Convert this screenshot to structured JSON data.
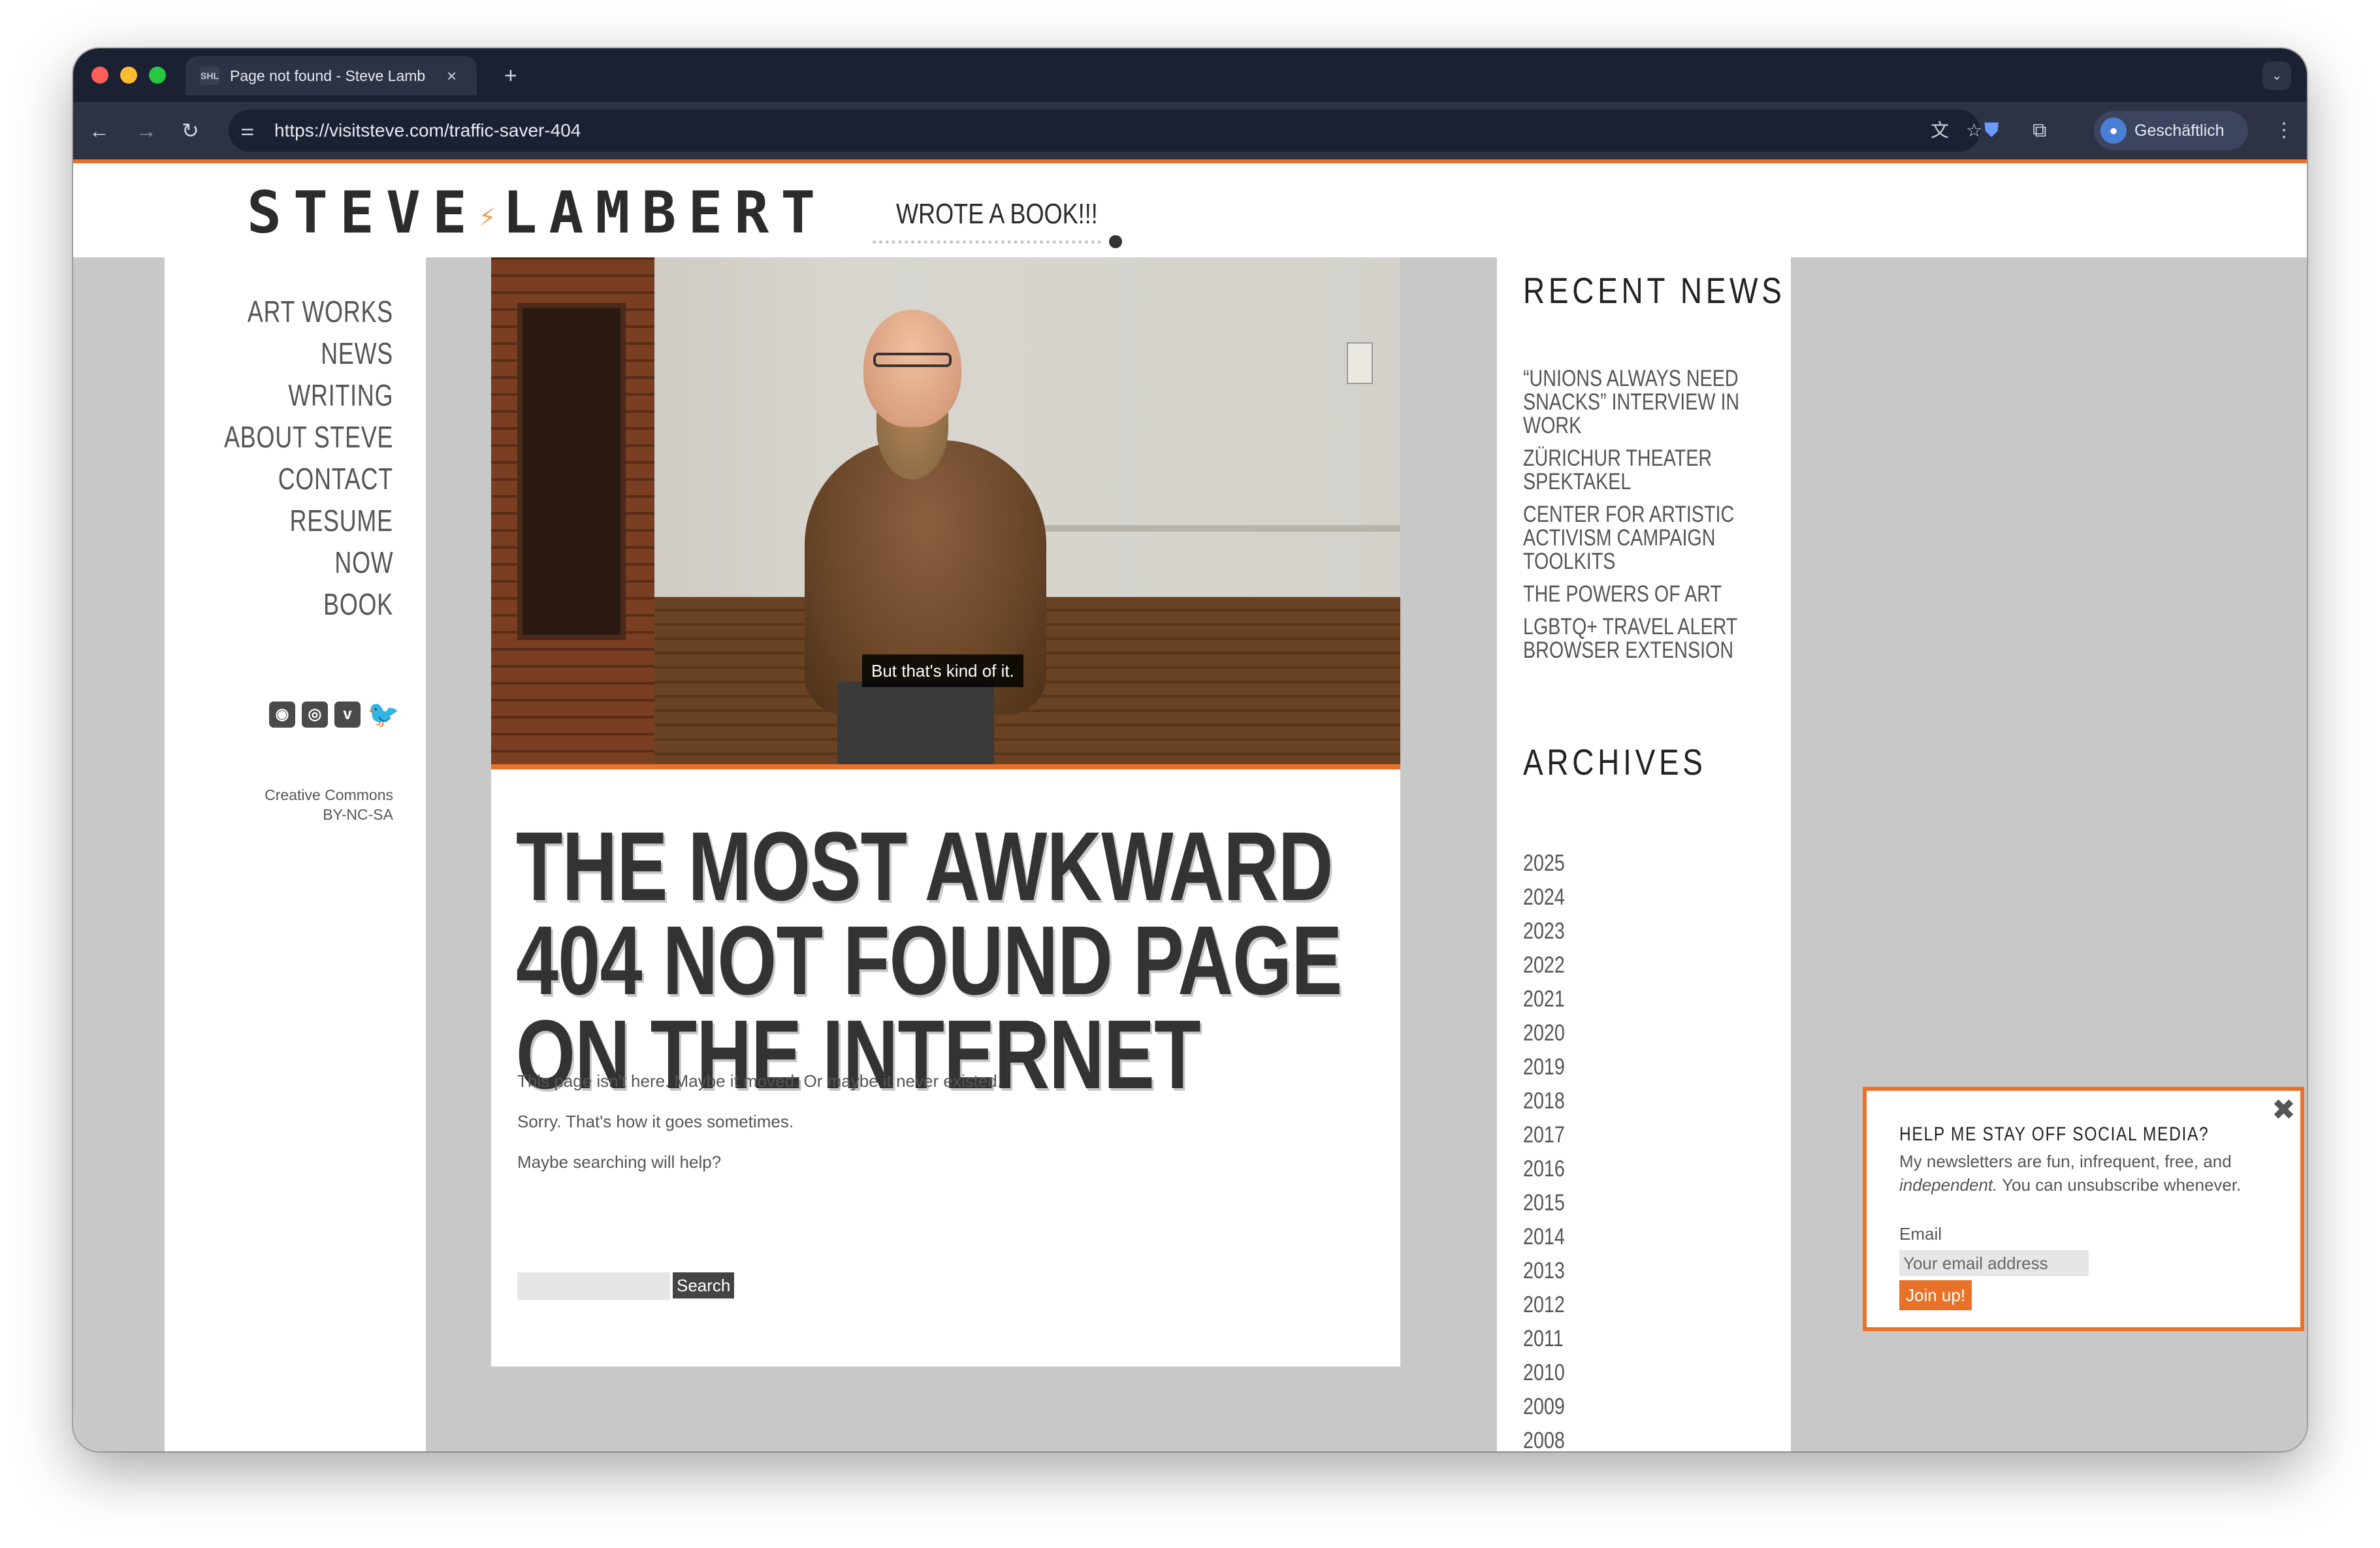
{
  "browser": {
    "tab": {
      "favicon": "SHL",
      "title": "Page not found - Steve Lambert",
      "close": "×"
    },
    "new_tab": "+",
    "tab_dropdown": "⌄",
    "nav": {
      "back": "←",
      "forward": "→",
      "reload": "↻"
    },
    "url": "https://visitsteve.com/traffic-saver-404",
    "site_info": "⚌",
    "icons": {
      "translate": "文",
      "star": "☆",
      "shield": "⛊",
      "extensions": "⧉",
      "menu": "⋮"
    },
    "profile": {
      "label": "Geschäftlich",
      "avatar": "●"
    }
  },
  "site": {
    "logo": {
      "left": "STEVE",
      "bolt": "⚡",
      "right": "LAMBERT"
    },
    "book_link": "WROTE A BOOK!!!"
  },
  "nav": [
    "ART WORKS",
    "NEWS",
    "WRITING",
    "ABOUT STEVE",
    "CONTACT",
    "RESUME",
    "NOW",
    "BOOK"
  ],
  "social": {
    "rss": "◉",
    "instagram": "◎",
    "vimeo": "v",
    "twitter": "🐦"
  },
  "license": {
    "line1": "Creative Commons",
    "line2": "BY-NC-SA"
  },
  "hero": {
    "caption": "But that's kind of it."
  },
  "main": {
    "headline": "THE MOST AWKWARD 404 NOT FOUND PAGE ON THE INTERNET",
    "paragraphs": [
      "This page isn't here. Maybe it moved. Or maybe it never existed.",
      "Sorry. That's how it goes sometimes.",
      "Maybe searching will help?"
    ],
    "search_button": "Search"
  },
  "sidebar": {
    "recent_heading": "RECENT NEWS",
    "recent": [
      "“UNIONS ALWAYS NEED SNACKS” INTERVIEW IN WORK",
      "ZÜRICHUR THEATER SPEKTAKEL",
      "CENTER FOR ARTISTIC ACTIVISM CAMPAIGN TOOLKITS",
      "THE POWERS OF ART",
      "LGBTQ+ TRAVEL ALERT BROWSER EXTENSION"
    ],
    "archives_heading": "ARCHIVES",
    "archives": [
      "2025",
      "2024",
      "2023",
      "2022",
      "2021",
      "2020",
      "2019",
      "2018",
      "2017",
      "2016",
      "2015",
      "2014",
      "2013",
      "2012",
      "2011",
      "2010",
      "2009",
      "2008"
    ]
  },
  "newsletter": {
    "close": "✖",
    "heading": "HELP ME STAY OFF SOCIAL MEDIA?",
    "desc_before": "My newsletters are fun, infrequent, free, and ",
    "desc_em": "independent.",
    "desc_after": " You can unsubscribe whenever.",
    "email_label": "Email",
    "email_placeholder": "Your email address",
    "button": "Join up!"
  }
}
